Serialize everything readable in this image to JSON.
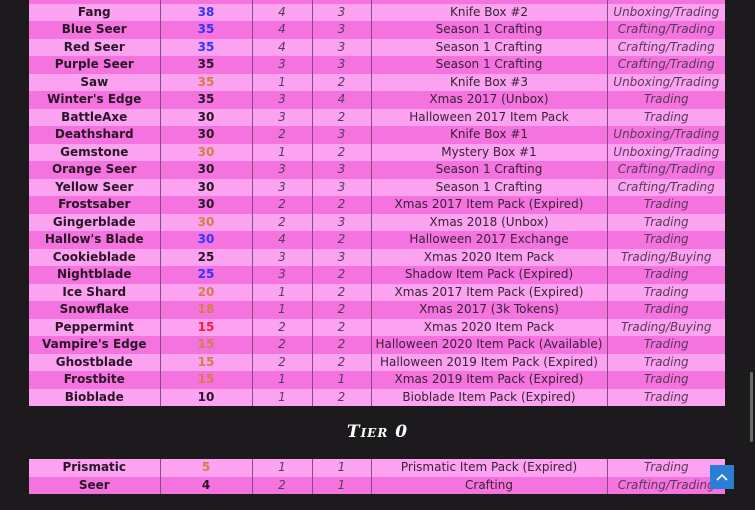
{
  "colors": {
    "blue": "#3434ff",
    "orange": "#d57d48",
    "red": "#ff1a3a",
    "dark": "#2a1628"
  },
  "tier1_rows": [
    {
      "name": "",
      "value": "",
      "c3": "",
      "c4": "",
      "source": "",
      "method": "",
      "color": "dark"
    },
    {
      "name": "Fang",
      "value": "38",
      "c3": "4",
      "c4": "3",
      "source": "Knife Box #2",
      "method": "Unboxing/Trading",
      "color": "blue"
    },
    {
      "name": "Blue Seer",
      "value": "35",
      "c3": "4",
      "c4": "3",
      "source": "Season 1 Crafting",
      "method": "Crafting/Trading",
      "color": "blue"
    },
    {
      "name": "Red Seer",
      "value": "35",
      "c3": "4",
      "c4": "3",
      "source": "Season 1 Crafting",
      "method": "Crafting/Trading",
      "color": "blue"
    },
    {
      "name": "Purple Seer",
      "value": "35",
      "c3": "3",
      "c4": "3",
      "source": "Season 1 Crafting",
      "method": "Crafting/Trading",
      "color": "dark"
    },
    {
      "name": "Saw",
      "value": "35",
      "c3": "1",
      "c4": "2",
      "source": "Knife Box #3",
      "method": "Unboxing/Trading",
      "color": "orange"
    },
    {
      "name": "Winter's Edge",
      "value": "35",
      "c3": "3",
      "c4": "4",
      "source": "Xmas 2017 (Unbox)",
      "method": "Trading",
      "color": "dark"
    },
    {
      "name": "BattleAxe",
      "value": "30",
      "c3": "3",
      "c4": "2",
      "source": "Halloween 2017 Item Pack",
      "method": "Trading",
      "color": "dark"
    },
    {
      "name": "Deathshard",
      "value": "30",
      "c3": "2",
      "c4": "3",
      "source": "Knife Box #1",
      "method": "Unboxing/Trading",
      "color": "dark"
    },
    {
      "name": "Gemstone",
      "value": "30",
      "c3": "1",
      "c4": "2",
      "source": "Mystery Box #1",
      "method": "Unboxing/Trading",
      "color": "orange"
    },
    {
      "name": "Orange Seer",
      "value": "30",
      "c3": "3",
      "c4": "3",
      "source": "Season 1 Crafting",
      "method": "Crafting/Trading",
      "color": "dark"
    },
    {
      "name": "Yellow Seer",
      "value": "30",
      "c3": "3",
      "c4": "3",
      "source": "Season 1 Crafting",
      "method": "Crafting/Trading",
      "color": "dark"
    },
    {
      "name": "Frostsaber",
      "value": "30",
      "c3": "2",
      "c4": "2",
      "source": "Xmas 2017 Item Pack (Expired)",
      "method": "Trading",
      "color": "dark"
    },
    {
      "name": "Gingerblade",
      "value": "30",
      "c3": "2",
      "c4": "3",
      "source": "Xmas 2018 (Unbox)",
      "method": "Trading",
      "color": "orange"
    },
    {
      "name": "Hallow's Blade",
      "value": "30",
      "c3": "4",
      "c4": "2",
      "source": "Halloween 2017 Exchange",
      "method": "Trading",
      "color": "blue"
    },
    {
      "name": "Cookieblade",
      "value": "25",
      "c3": "3",
      "c4": "3",
      "source": "Xmas 2020 Item Pack",
      "method": "Trading/Buying",
      "color": "dark"
    },
    {
      "name": "Nightblade",
      "value": "25",
      "c3": "3",
      "c4": "2",
      "source": "Shadow Item Pack (Expired)",
      "method": "Trading",
      "color": "blue"
    },
    {
      "name": "Ice Shard",
      "value": "20",
      "c3": "1",
      "c4": "2",
      "source": "Xmas 2017 Item Pack (Expired)",
      "method": "Trading",
      "color": "orange"
    },
    {
      "name": "Snowflake",
      "value": "18",
      "c3": "1",
      "c4": "2",
      "source": "Xmas 2017 (3k Tokens)",
      "method": "Trading",
      "color": "orange"
    },
    {
      "name": "Peppermint",
      "value": "15",
      "c3": "2",
      "c4": "2",
      "source": "Xmas 2020 Item Pack",
      "method": "Trading/Buying",
      "color": "red"
    },
    {
      "name": "Vampire's Edge",
      "value": "15",
      "c3": "2",
      "c4": "2",
      "source": "Halloween 2020 Item Pack (Available)",
      "method": "Trading",
      "color": "orange"
    },
    {
      "name": "Ghostblade",
      "value": "15",
      "c3": "2",
      "c4": "2",
      "source": "Halloween 2019 Item Pack (Expired)",
      "method": "Trading",
      "color": "orange"
    },
    {
      "name": "Frostbite",
      "value": "15",
      "c3": "1",
      "c4": "1",
      "source": "Xmas 2019 Item Pack (Expired)",
      "method": "Trading",
      "color": "orange"
    },
    {
      "name": "Bioblade",
      "value": "10",
      "c3": "1",
      "c4": "2",
      "source": "Bioblade Item Pack (Expired)",
      "method": "Trading",
      "color": "dark"
    }
  ],
  "tier0_heading": "Tier 0",
  "tier0_rows": [
    {
      "name": "Prismatic",
      "value": "5",
      "c3": "1",
      "c4": "1",
      "source": "Prismatic Item Pack (Expired)",
      "method": "Trading",
      "color": "orange"
    },
    {
      "name": "Seer",
      "value": "4",
      "c3": "2",
      "c4": "1",
      "source": "Crafting",
      "method": "Crafting/Trading",
      "color": "dark"
    }
  ],
  "icons": {
    "scroll_top": "chevron-up-icon"
  }
}
